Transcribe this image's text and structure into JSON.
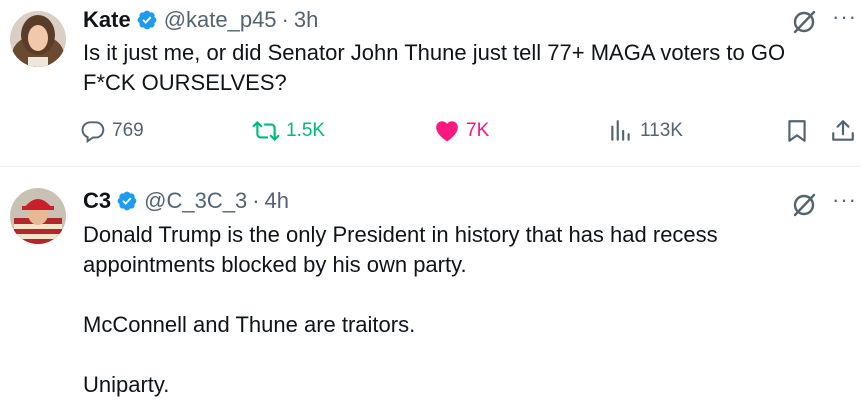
{
  "tweets": [
    {
      "name": "Kate",
      "handle": "@kate_p45",
      "dot": "·",
      "time": "3h",
      "text": "Is it just me, or did Senator John Thune just tell 77+ MAGA voters to GO F*CK OURSELVES?",
      "stats": {
        "replies": "769",
        "reposts": "1.5K",
        "likes": "7K",
        "views": "113K"
      }
    },
    {
      "name": "C3",
      "handle": "@C_3C_3",
      "dot": "·",
      "time": "4h",
      "paragraphs": [
        "Donald Trump is the only President in history that has had recess appointments blocked by his own party.",
        "McConnell and Thune are traitors.",
        "Uniparty."
      ]
    }
  ],
  "more_glyph": "···",
  "colors": {
    "verified": "#1d9bf0",
    "like": "#f91880",
    "repost": "#00ba7c",
    "secondary_text": "#536471"
  },
  "icons": [
    "verified-badge-icon",
    "grok-icon",
    "more-icon",
    "reply-icon",
    "repost-icon",
    "like-icon",
    "views-icon",
    "bookmark-icon",
    "share-icon"
  ]
}
